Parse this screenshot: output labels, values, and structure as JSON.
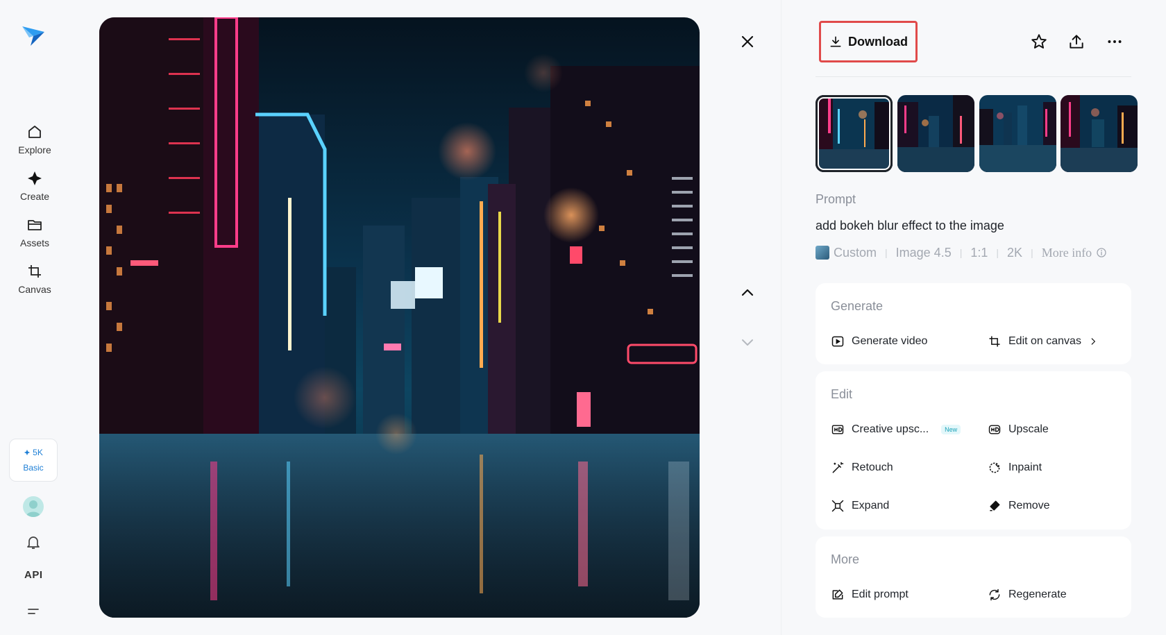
{
  "nav": {
    "items": [
      {
        "label": "Explore",
        "icon": "home-icon"
      },
      {
        "label": "Create",
        "icon": "sparkle-icon"
      },
      {
        "label": "Assets",
        "icon": "folder-icon"
      },
      {
        "label": "Canvas",
        "icon": "crop-icon"
      }
    ],
    "credits": {
      "amount": "5K",
      "plan": "Basic"
    },
    "api_label": "API"
  },
  "toolbar": {
    "download_label": "Download"
  },
  "prompt": {
    "label": "Prompt",
    "text": "add bokeh blur effect to the image",
    "meta": {
      "style": "Custom",
      "model": "Image 4.5",
      "ratio": "1:1",
      "resolution": "2K",
      "more_info": "More info"
    }
  },
  "generate": {
    "title": "Generate",
    "actions": [
      "Generate video",
      "Edit on canvas"
    ]
  },
  "edit": {
    "title": "Edit",
    "actions": [
      "Creative upsc...",
      "Upscale",
      "Retouch",
      "Inpaint",
      "Expand",
      "Remove"
    ],
    "new_badge": "New"
  },
  "more": {
    "title": "More",
    "actions": [
      "Edit prompt",
      "Regenerate"
    ]
  },
  "colors": {
    "accent_blue": "#1e7fd6",
    "highlight_red": "#e04a4a",
    "panel_bg": "#ffffff",
    "page_bg": "#f7f8fa"
  }
}
